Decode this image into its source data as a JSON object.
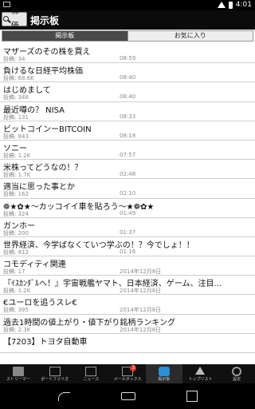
{
  "status": {
    "time": "4:01"
  },
  "header": {
    "search_label": "株価",
    "title": "掲示板"
  },
  "tabs": [
    {
      "label": "掲示板"
    },
    {
      "label": "お気に入り"
    }
  ],
  "rows": [
    {
      "title": "マザーズのその株を買え",
      "meta": "投稿: 34",
      "time": "08:59"
    },
    {
      "title": "負けるな日経平均株価",
      "meta": "投稿: 68.6K",
      "time": "08:40"
    },
    {
      "title": "はじめまして",
      "meta": "投稿: 348",
      "time": "08:40"
    },
    {
      "title": "最近噂の？ NISA",
      "meta": "投稿: 131",
      "time": "08:33"
    },
    {
      "title": "ビットコインーBITCOIN",
      "meta": "投稿: 843",
      "time": "08:18"
    },
    {
      "title": "ソニー",
      "meta": "投稿: 1.2K",
      "time": "07:57"
    },
    {
      "title": "米株ってどうなの！？",
      "meta": "投稿: 1.7K",
      "time": "02:48"
    },
    {
      "title": "適当に思った事とか",
      "meta": "投稿: 162",
      "time": "02:10"
    },
    {
      "title": "❁★✿★〜カッコイイ車を貼ろう〜★❁✿★",
      "meta": "投稿: 324",
      "time": "01:49"
    },
    {
      "title": "ガンホー",
      "meta": "投稿: 200",
      "time": "01:37"
    },
    {
      "title": "世界経済、今学ばなくていつ学ぶの！？今でしょ！！",
      "meta": "投稿: 812",
      "time": "01:16"
    },
    {
      "title": "コモディティ関連",
      "meta": "投稿: 17",
      "time": "2014年12月8日"
    },
    {
      "title": "『ｲｽｶﾝﾀﾞﾙへ！』宇宙戦艦ヤマト、日本経済、ゲーム、注目...",
      "meta": "投稿: 1.2K",
      "time": "2014年12月8日"
    },
    {
      "title": "€ユーロを追うスレ€",
      "meta": "投稿: 395",
      "time": "2014年12月8日"
    },
    {
      "title": "過去1時間の値上がり・値下がり銘柄ランキング",
      "meta": "投稿: 2.3K",
      "time": "2014年12月8日"
    },
    {
      "title": "【7203】トヨタ自動車",
      "meta": "",
      "time": ""
    }
  ],
  "bottom_nav": [
    {
      "label": "ストリーマー",
      "icon": "streamer-icon"
    },
    {
      "label": "ポートフォリオ",
      "icon": "portfolio-icon"
    },
    {
      "label": "ニュース",
      "icon": "news-icon"
    },
    {
      "label": "メールボックス",
      "icon": "mail-icon",
      "badge": "3"
    },
    {
      "label": "掲示板",
      "icon": "board-icon"
    },
    {
      "label": "トップリスト",
      "icon": "toplist-icon"
    },
    {
      "label": "設定",
      "icon": "settings-icon"
    }
  ]
}
